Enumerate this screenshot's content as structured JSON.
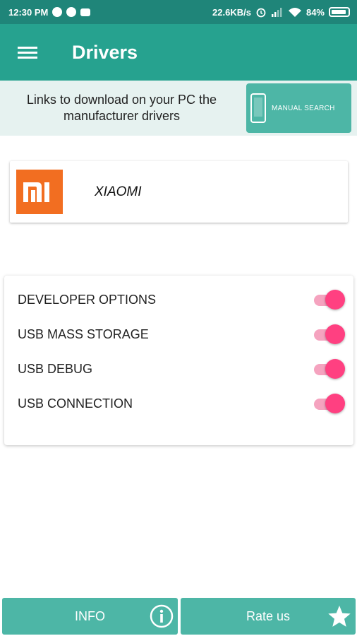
{
  "status_bar": {
    "time": "12:30 PM",
    "net_speed": "22.6KB/s",
    "battery": "84%"
  },
  "app_bar": {
    "title": "Drivers",
    "menu_icon": "hamburger-menu-icon"
  },
  "banner": {
    "text": "Links to download on your PC the manufacturer drivers",
    "button_label": "MANUAL SEARCH",
    "button_icon": "phone-icon"
  },
  "brand": {
    "name": "XIAOMI",
    "logo_color": "#f26e21"
  },
  "options": [
    {
      "label": "DEVELOPER OPTIONS",
      "enabled": true
    },
    {
      "label": "USB MASS STORAGE",
      "enabled": true
    },
    {
      "label": "USB DEBUG",
      "enabled": true
    },
    {
      "label": "USB CONNECTION",
      "enabled": true
    }
  ],
  "bottom": {
    "info_label": "INFO",
    "info_icon": "info-circle-icon",
    "rate_label": "Rate us",
    "rate_icon": "star-icon"
  },
  "colors": {
    "status_bar": "#1f8579",
    "app_bar": "#26a28f",
    "button": "#4db6a6",
    "banner_bg": "#e6f2f0",
    "toggle_on": "#ff4081"
  }
}
